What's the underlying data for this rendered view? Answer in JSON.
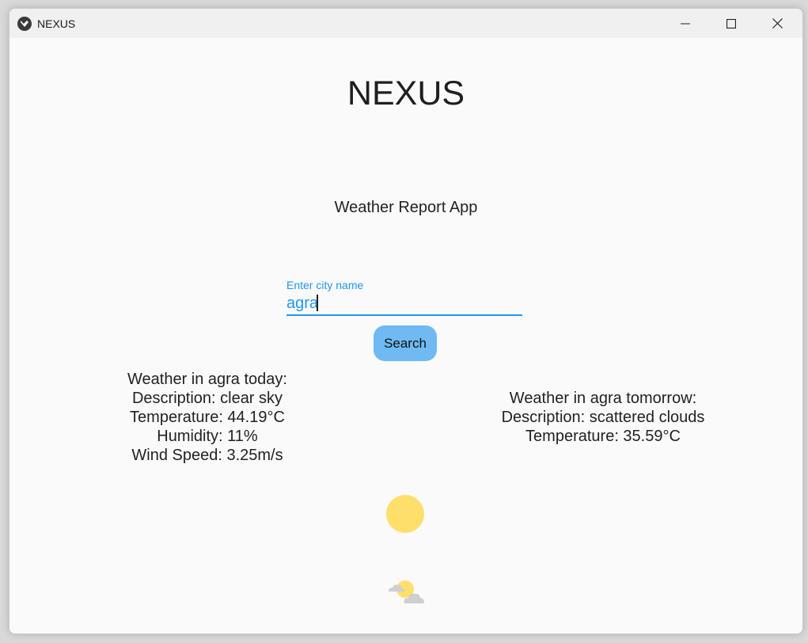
{
  "window": {
    "title": "NEXUS",
    "app_icon": "kivy-logo-icon",
    "controls": [
      "minimize-icon",
      "maximize-icon",
      "close-icon"
    ]
  },
  "app": {
    "heading": "NEXUS",
    "subtitle": "Weather Report App"
  },
  "search": {
    "label": "Enter city name",
    "value": "agra",
    "button_label": "Search"
  },
  "today": {
    "title": "Weather in agra today:",
    "description": "Description: clear sky",
    "temperature": "Temperature: 44.19°C",
    "humidity": "Humidity: 11%",
    "wind": "Wind Speed: 3.25m/s",
    "icon": "sun-icon"
  },
  "tomorrow": {
    "title": "Weather in agra tomorrow:",
    "description": "Description: scattered clouds",
    "temperature": "Temperature: 35.59°C",
    "icon": "sun-behind-cloud-icon"
  },
  "colors": {
    "accent": "#2196f3",
    "button": "#6fbaf2",
    "sun": "#ffdf6b",
    "cloud": "#cfcfcf",
    "background": "#fafafa"
  }
}
